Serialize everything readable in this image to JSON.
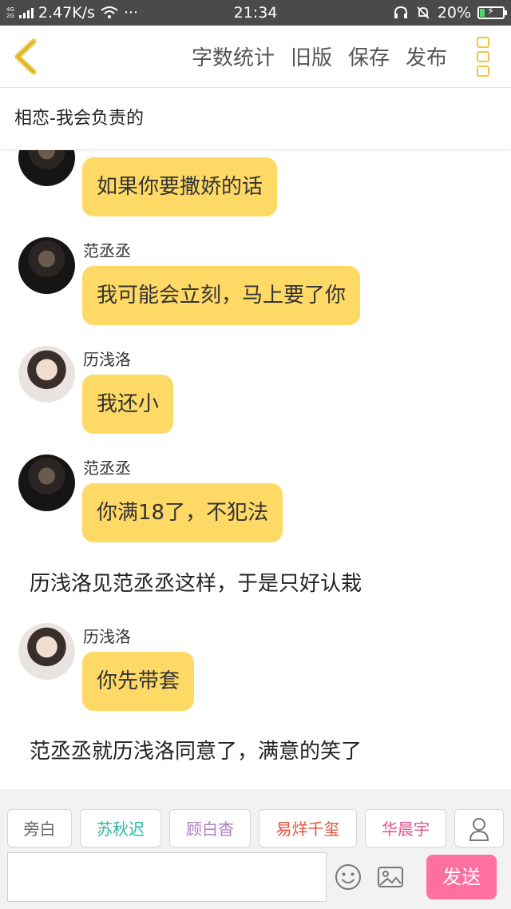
{
  "status_bar": {
    "net_top": "4G",
    "net_bottom": "2G",
    "speed": "2.47K/s",
    "dots": "···",
    "time": "21:34",
    "battery": "20%",
    "battery_level": 0.2,
    "battery_color": "#4cd964"
  },
  "toolbar": {
    "back_icon": "chevron-left-icon",
    "word_count": "字数统计",
    "old_version": "旧版",
    "save": "保存",
    "publish": "发布",
    "more_icon": "more-vertical-icon"
  },
  "story_title": "相恋-我会负责的",
  "messages": [
    {
      "type": "bubble",
      "speaker": "",
      "avatar": "male",
      "text": "如果你要撒娇的话"
    },
    {
      "type": "bubble",
      "speaker": "范丞丞",
      "avatar": "male",
      "text": "我可能会立刻，马上要了你"
    },
    {
      "type": "bubble",
      "speaker": "历浅洛",
      "avatar": "female",
      "text": "我还小"
    },
    {
      "type": "bubble",
      "speaker": "范丞丞",
      "avatar": "male",
      "text": "你满18了，不犯法"
    },
    {
      "type": "narration",
      "text": "历浅洛见范丞丞这样，于是只好认栽"
    },
    {
      "type": "bubble",
      "speaker": "历浅洛",
      "avatar": "female",
      "text": "你先带套"
    },
    {
      "type": "narration",
      "text": "范丞丞就历浅洛同意了，满意的笑了"
    }
  ],
  "roles": [
    {
      "label": "旁白",
      "color": "#666666"
    },
    {
      "label": "苏秋迟",
      "color": "#2bb5a8"
    },
    {
      "label": "顾白杳",
      "color": "#b07cc6"
    },
    {
      "label": "易烊千玺",
      "color": "#e0523a"
    },
    {
      "label": "华晨宇",
      "color": "#e0528a"
    }
  ],
  "input": {
    "placeholder": ""
  },
  "send_label": "发送",
  "accent_color": "#ffd966",
  "send_color": "#ff6fa0"
}
